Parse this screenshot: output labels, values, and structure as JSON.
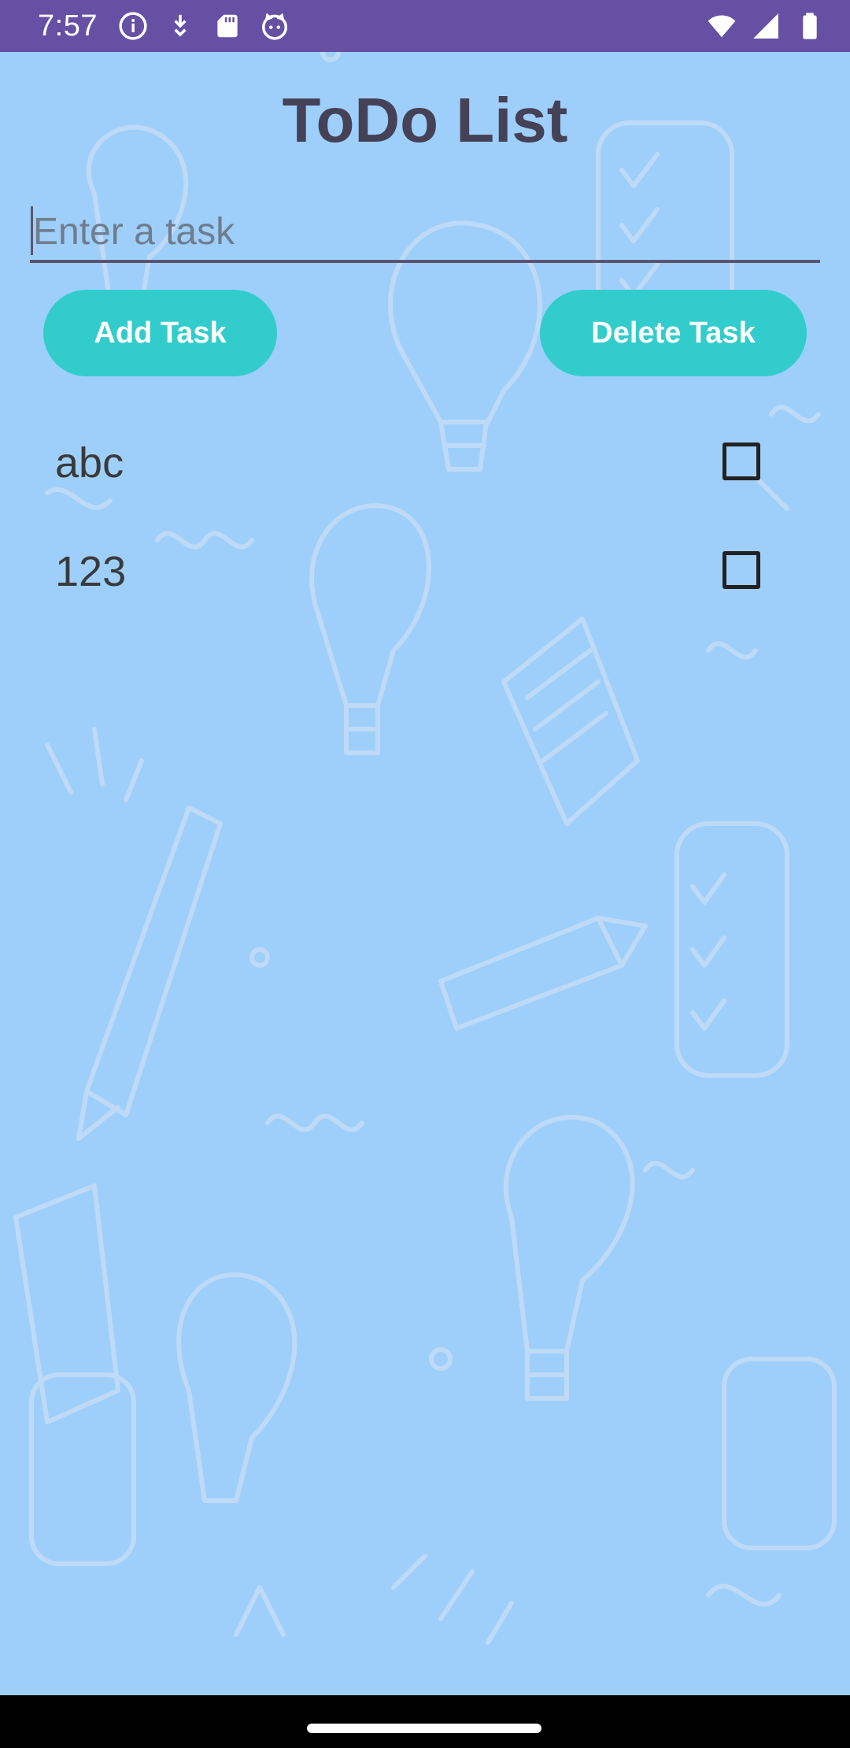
{
  "status_bar": {
    "time": "7:57",
    "left_icons": [
      "info-icon",
      "download-icon",
      "sd-card-icon",
      "cat-face-icon"
    ],
    "right_icons": [
      "wifi-icon",
      "signal-icon",
      "battery-icon"
    ],
    "color": "#6650a4"
  },
  "app": {
    "title": "ToDo List",
    "background_color": "#9ecffb"
  },
  "input": {
    "placeholder": "Enter a task",
    "value": ""
  },
  "buttons": {
    "add_label": "Add Task",
    "delete_label": "Delete Task",
    "color": "#33cccc"
  },
  "tasks": [
    {
      "label": "abc",
      "checked": false
    },
    {
      "label": "123",
      "checked": false
    }
  ]
}
